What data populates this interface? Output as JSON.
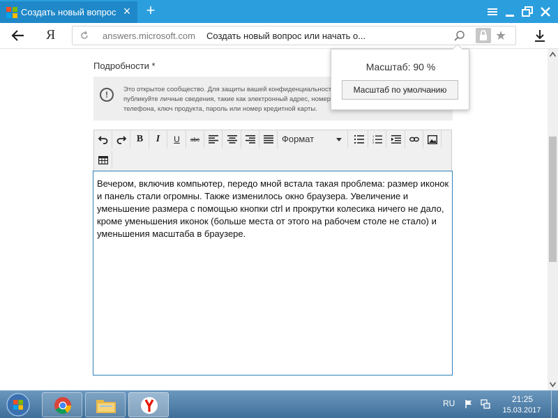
{
  "browser": {
    "tab_title": "Создать новый вопрос и",
    "url_host": "answers.microsoft.com",
    "url_title": "Создать новый вопрос или начать о...",
    "yandex_button": "Я"
  },
  "zoom_popup": {
    "label": "Масштаб: 90 %",
    "default_button": "Масштаб по умолчанию"
  },
  "form": {
    "details_label": "Подробности *",
    "notice_text": "Это открытое сообщество. Для защиты вашей конфиденциальности не публикуйте личные сведения, такие как электронный адрес, номер телефона, ключ продукта, пароль или номер кредитной карты."
  },
  "editor": {
    "format_label": "Формат",
    "buttons": {
      "bold": "B",
      "italic": "I",
      "underline": "U",
      "strike": "abc"
    },
    "content": "Вечером, включив компьютер, передо мной встала такая проблема: размер иконок и панель стали огромны. Также изменилось окно браузера. Увеличение и уменьшение размера с помощью кнопки ctrl и прокрутки колесика ничего не дало, кроме уменьшения иконок (больше места от этого на рабочем столе не стало) и уменьшения масштаба в браузере."
  },
  "taskbar": {
    "language": "RU",
    "time": "21:25",
    "date": "15.03.2017"
  },
  "colors": {
    "titlebar": "#2b9edd",
    "active_tab": "#1f88c8",
    "editor_border": "#2d7fb9",
    "taskbar": "#4f7ea7"
  }
}
